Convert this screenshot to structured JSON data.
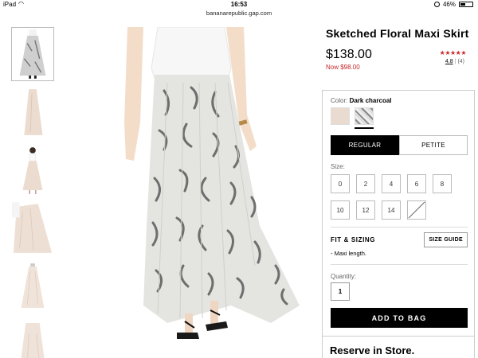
{
  "status": {
    "device": "iPad",
    "time": "16:53",
    "battery": "46%",
    "battery_level": 0.46
  },
  "url": "bananarepublic.gap.com",
  "product": {
    "title": "Sketched Floral Maxi Skirt",
    "price": "$138.00",
    "now_price": "Now $98.00",
    "stars": "★★★★★",
    "rating_avg": "4.8",
    "rating_sep": "|",
    "rating_count": "(4)"
  },
  "color": {
    "label": "Color:",
    "selected": "Dark charcoal"
  },
  "fit": {
    "options": [
      "REGULAR",
      "PETITE"
    ],
    "selected": "REGULAR"
  },
  "size": {
    "label": "Size:",
    "options": [
      "0",
      "2",
      "4",
      "6",
      "8",
      "10",
      "12",
      "14",
      ""
    ]
  },
  "fit_sizing": {
    "heading": "FIT & SIZING",
    "guide_button": "SIZE GUIDE",
    "detail": "- Maxi length."
  },
  "quantity": {
    "label": "Quantity:",
    "value": "1"
  },
  "add_to_bag": "ADD TO BAG",
  "reserve": "Reserve in Store.",
  "colors": {
    "accent_red": "#c9262a",
    "primary_black": "#000000"
  }
}
